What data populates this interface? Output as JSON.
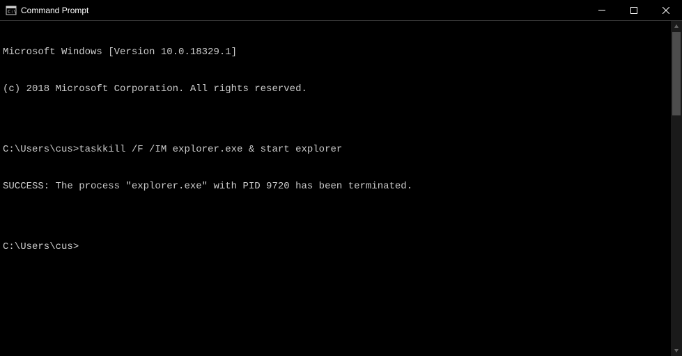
{
  "titlebar": {
    "title": "Command Prompt"
  },
  "terminal": {
    "lines": [
      "Microsoft Windows [Version 10.0.18329.1]",
      "(c) 2018 Microsoft Corporation. All rights reserved.",
      "",
      "C:\\Users\\cus>taskkill /F /IM explorer.exe & start explorer",
      "SUCCESS: The process \"explorer.exe\" with PID 9720 has been terminated.",
      "",
      "C:\\Users\\cus>"
    ]
  }
}
